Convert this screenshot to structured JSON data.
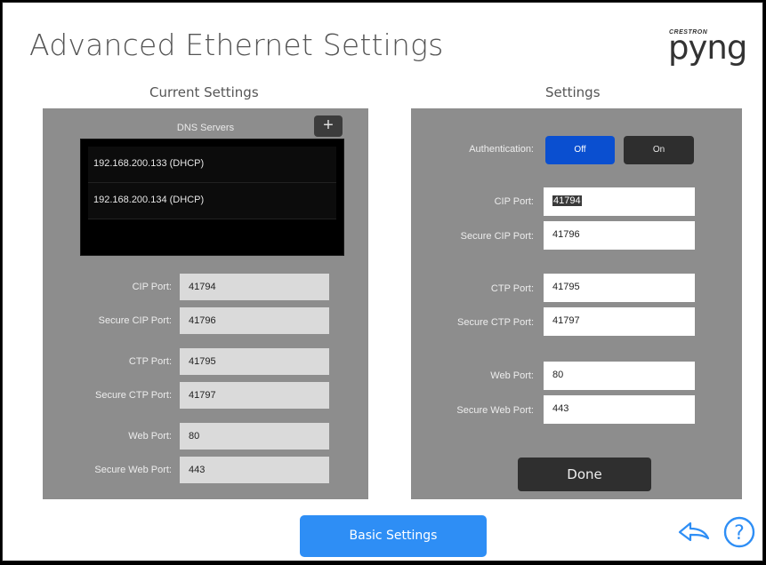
{
  "page": {
    "title": "Advanced Ethernet Settings",
    "logo_brand": "CRESTRON",
    "logo_word": "pyng"
  },
  "current": {
    "section_title": "Current Settings",
    "dns_label": "DNS Servers",
    "add_label": "+",
    "dns_servers": [
      "192.168.200.133 (DHCP)",
      "192.168.200.134 (DHCP)"
    ],
    "fields": [
      {
        "label": "CIP Port:",
        "value": "41794"
      },
      {
        "label": "Secure CIP Port:",
        "value": "41796"
      },
      {
        "label": "CTP Port:",
        "value": "41795"
      },
      {
        "label": "Secure CTP Port:",
        "value": "41797"
      },
      {
        "label": "Web Port:",
        "value": "80"
      },
      {
        "label": "Secure Web Port:",
        "value": "443"
      }
    ]
  },
  "settings": {
    "section_title": "Settings",
    "auth_label": "Authentication:",
    "auth_off": "Off",
    "auth_on": "On",
    "auth_selected": "Off",
    "fields": [
      {
        "label": "CIP Port:",
        "value": "41794"
      },
      {
        "label": "Secure CIP Port:",
        "value": "41796"
      },
      {
        "label": "CTP Port:",
        "value": "41795"
      },
      {
        "label": "Secure CTP Port:",
        "value": "41797"
      },
      {
        "label": "Web Port:",
        "value": "80"
      },
      {
        "label": "Secure Web Port:",
        "value": "443"
      }
    ],
    "done_label": "Done"
  },
  "footer": {
    "basic_settings_label": "Basic Settings",
    "back_icon": "back-arrow-icon",
    "help_icon": "help-icon",
    "help_glyph": "?"
  },
  "colors": {
    "accent_blue": "#2e8ef5",
    "auth_off_blue": "#0a4fd0",
    "panel_gray": "#8d8d8d"
  }
}
